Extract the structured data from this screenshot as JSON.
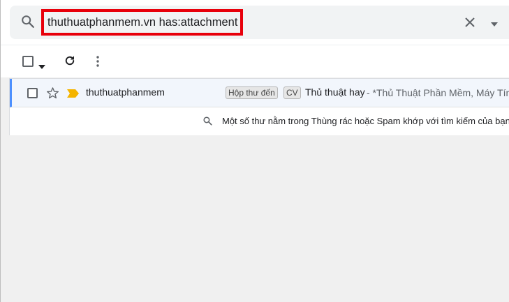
{
  "search": {
    "query": "thuthuatphanmem.vn has:attachment"
  },
  "icons": {
    "search": "search-icon",
    "clear": "close-icon",
    "options": "chevron-down-icon",
    "refresh": "refresh-icon",
    "more": "more-vert-icon",
    "star": "star-icon",
    "important": "important-marker-icon"
  },
  "mail": {
    "sender": "thuthuatphanmem",
    "labels": [
      "Hộp thư đến",
      "CV"
    ],
    "subject": "Thủ thuật hay",
    "snippet": " - *Thủ Thuật Phần Mềm, Máy Tính"
  },
  "notice": {
    "text": "Một số thư nằm trong Thùng rác hoặc Spam khớp với tìm kiếm của bạn. Xem thư"
  },
  "colors": {
    "highlight_border": "#e8000b",
    "important_marker": "#f4b400",
    "selected_row_bar": "#4d90fe"
  }
}
